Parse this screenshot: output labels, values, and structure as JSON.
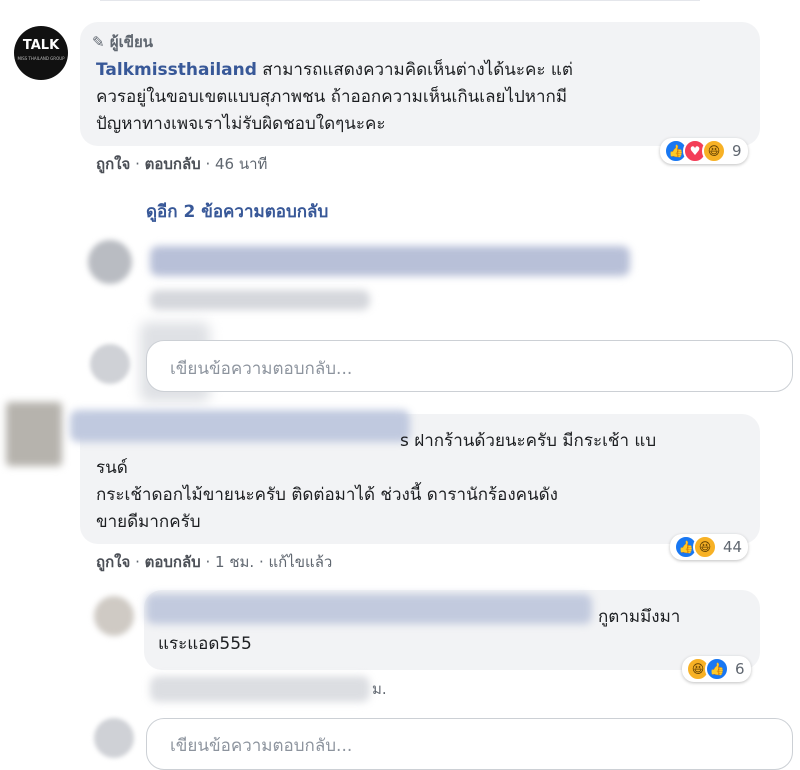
{
  "top_comment": {
    "avatar_text": "TALK",
    "avatar_subtext": "MISS THAILAND GROUP",
    "author_badge": "ผู้เขียน",
    "author": "Talkmissthailand",
    "text_line1": "สามารถแสดงความคิดเห็นต่างได้นะคะ แต่",
    "text_line2": "ควรอยู่ในขอบเขตแบบสุภาพชน ถ้าออกความเห็นเกินเลยไปหากมี",
    "text_line3": "ปัญหาทางเพจเราไม่รับผิดชอบใดๆนะคะ",
    "like": "ถูกใจ",
    "reply": "ตอบกลับ",
    "time": "46 นาที",
    "reaction_count": "9"
  },
  "view_replies": "ดูอีก 2 ข้อความตอบกลับ",
  "reply_input_1": {
    "placeholder": "เขียนข้อความตอบกลับ..."
  },
  "second_comment": {
    "text_tail": "s ฝากร้านด้วยนะครับ มีกระเช้า แบ",
    "text_line2": "รนด์",
    "text_line3": "กระเช้าดอกไม้ขายนะครับ ติดต่อมาได้ ช่วงนี้ ดารานักร้องคนดัง",
    "text_line4": "ขายดีมากครับ",
    "like": "ถูกใจ",
    "reply": "ตอบกลับ",
    "time": "1 ชม.",
    "edited": "แก้ไขแล้ว",
    "reaction_count": "44"
  },
  "nested_reply": {
    "text_tail": "กูตามมึงมา",
    "text_line2": "แระแอด555",
    "reaction_count": "6",
    "meta_tail": "ม."
  },
  "reply_input_2": {
    "placeholder": "เขียนข้อความตอบกลับ..."
  },
  "colors": {
    "link": "#385898",
    "bubble": "#f2f3f5",
    "like": "#1877f2",
    "love": "#f33e58",
    "haha": "#f7b125"
  }
}
